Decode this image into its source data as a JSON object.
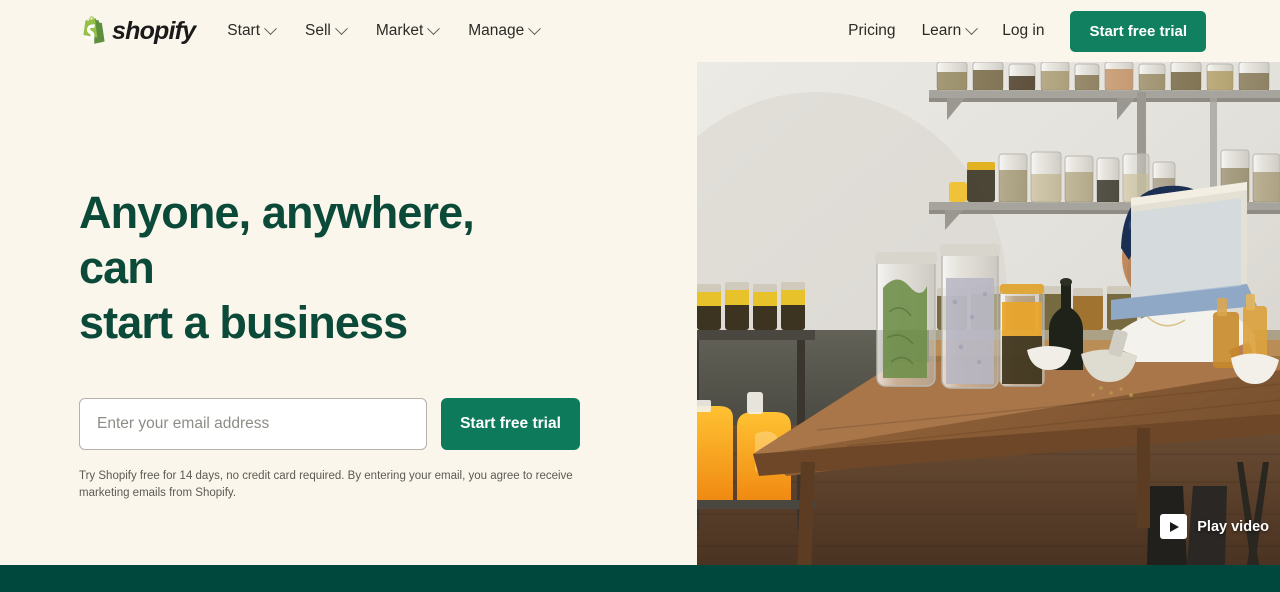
{
  "brand": {
    "name": "shopify",
    "logo_icon": "shopify-bag-icon",
    "colors": {
      "background": "#FAF6EC",
      "headline_green": "#0B4A38",
      "button_green": "#108060",
      "band_green": "#00473E"
    }
  },
  "nav": {
    "main_items": [
      {
        "label": "Start",
        "has_dropdown": true
      },
      {
        "label": "Sell",
        "has_dropdown": true
      },
      {
        "label": "Market",
        "has_dropdown": true
      },
      {
        "label": "Manage",
        "has_dropdown": true
      }
    ],
    "right_items": [
      {
        "label": "Pricing",
        "has_dropdown": false
      },
      {
        "label": "Learn",
        "has_dropdown": true
      },
      {
        "label": "Log in",
        "has_dropdown": false
      }
    ],
    "cta_label": "Start free trial"
  },
  "hero": {
    "headline_line1": "Anyone, anywhere, can",
    "headline_line2": "start a business",
    "email_placeholder": "Enter your email address",
    "email_value": "",
    "cta_label": "Start free trial",
    "legal": "Try Shopify free for 14 days, no credit card required. By entering your email, you agree to receive marketing emails from Shopify."
  },
  "media": {
    "play_label": "Play video",
    "play_icon": "play-triangle-icon",
    "alt": "Woman in navy headwrap and blue denim apron working at a laptop on a wooden table with glass jars of herbs and spices on metal shelves"
  }
}
